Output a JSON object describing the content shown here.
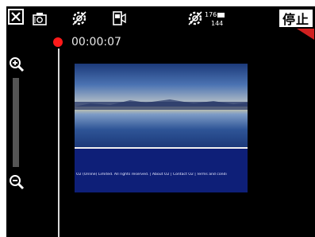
{
  "toolbar": {
    "close_icon": "close-icon",
    "camera_icon": "camera-icon",
    "settings_icon": "gear-icon",
    "video_mode_icon": "video-camera-icon",
    "resolution_settings_icon": "gear-icon",
    "resolution_top": "176",
    "resolution_bottom": "144",
    "stop_label": "停止"
  },
  "recording": {
    "indicator_color": "#ff1a1a",
    "elapsed_time": "00:00:07"
  },
  "zoom": {
    "zoom_in_icon": "zoom-in-icon",
    "zoom_out_icon": "zoom-out-icon"
  },
  "preview": {
    "footer_text": "O2 (Online) Limited. All rights reserved. | About O2 | Contact O2 | Terms and condi"
  },
  "colors": {
    "background": "#000000",
    "stop_accent": "#d02020",
    "preview_lower": "#0e1f78"
  }
}
